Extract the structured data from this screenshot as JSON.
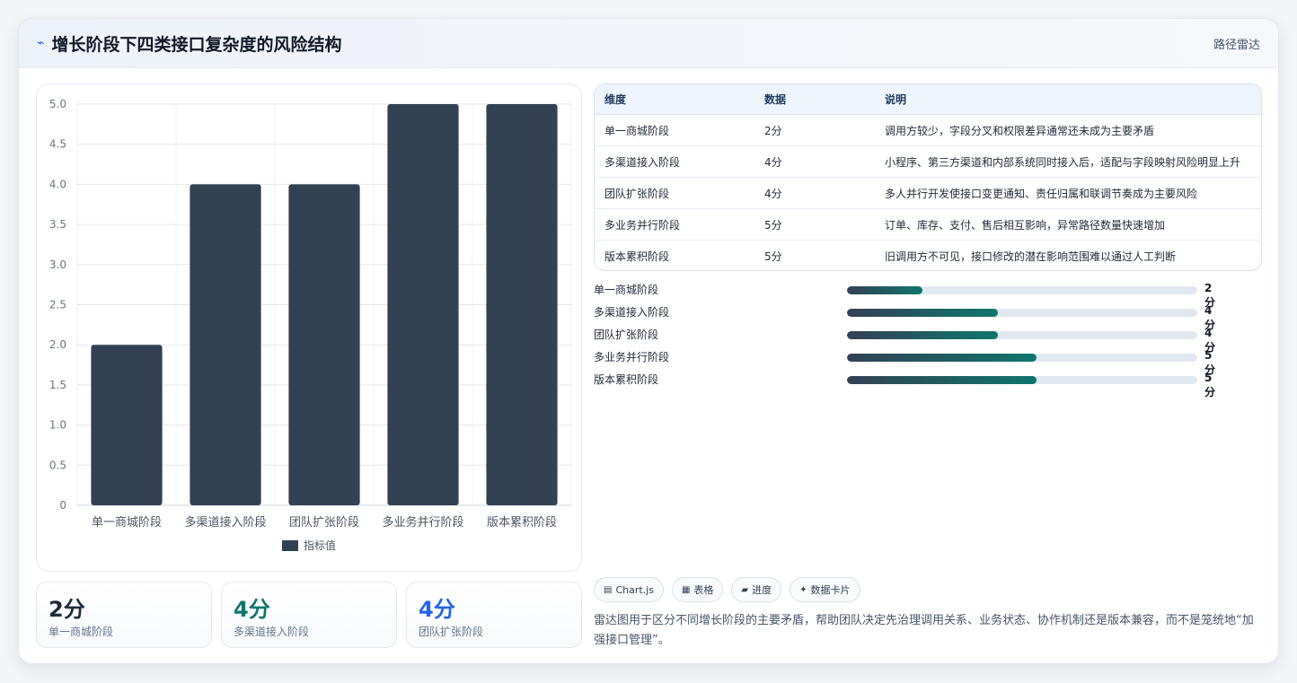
{
  "header": {
    "title": "增长阶段下四类接口复杂度的风险结构",
    "tag": "路径雷达",
    "icon": "pulse-icon"
  },
  "chart_data": {
    "type": "bar",
    "categories": [
      "单一商城阶段",
      "多渠道接入阶段",
      "团队扩张阶段",
      "多业务并行阶段",
      "版本累积阶段"
    ],
    "series": [
      {
        "name": "指标值",
        "values": [
          2,
          4,
          4,
          5,
          5
        ],
        "color": "#334155"
      }
    ],
    "ylim": [
      0,
      5
    ],
    "yticks": [
      "0",
      "0.5",
      "1.0",
      "1.5",
      "2.0",
      "2.5",
      "3.0",
      "3.5",
      "4.0",
      "4.5",
      "5.0"
    ],
    "grid": true,
    "legend": "bottom"
  },
  "stats": [
    {
      "value": "2分",
      "label": "单一商城阶段",
      "color": "#1f2937"
    },
    {
      "value": "4分",
      "label": "多渠道接入阶段",
      "color": "#0f766e"
    },
    {
      "value": "4分",
      "label": "团队扩张阶段",
      "color": "#2563eb"
    }
  ],
  "table": {
    "headers": [
      "维度",
      "数据",
      "说明"
    ],
    "rows": [
      [
        "单一商城阶段",
        "2分",
        "调用方较少，字段分叉和权限差异通常还未成为主要矛盾"
      ],
      [
        "多渠道接入阶段",
        "4分",
        "小程序、第三方渠道和内部系统同时接入后，适配与字段映射风险明显上升"
      ],
      [
        "团队扩张阶段",
        "4分",
        "多人并行开发使接口变更通知、责任归属和联调节奏成为主要风险"
      ],
      [
        "多业务并行阶段",
        "5分",
        "订单、库存、支付、售后相互影响，异常路径数量快速增加"
      ],
      [
        "版本累积阶段",
        "5分",
        "旧调用方不可见，接口修改的潜在影响范围难以通过人工判断"
      ]
    ]
  },
  "progress": [
    {
      "label": "单一商城阶段",
      "value": "2分",
      "fraction": 0.216
    },
    {
      "label": "多渠道接入阶段",
      "value": "4分",
      "fraction": 0.432
    },
    {
      "label": "团队扩张阶段",
      "value": "4分",
      "fraction": 0.432
    },
    {
      "label": "多业务并行阶段",
      "value": "5分",
      "fraction": 0.54
    },
    {
      "label": "版本累积阶段",
      "value": "5分",
      "fraction": 0.54
    }
  ],
  "chips": [
    {
      "icon": "chart-icon",
      "glyph": "▤",
      "label": "Chart.js"
    },
    {
      "icon": "table-icon",
      "glyph": "▦",
      "label": "表格"
    },
    {
      "icon": "progress-icon",
      "glyph": "▰",
      "label": "进度"
    },
    {
      "icon": "sparkle-icon",
      "glyph": "✦",
      "label": "数据卡片"
    }
  ],
  "note": "雷达图用于区分不同增长阶段的主要矛盾，帮助团队决定先治理调用关系、业务状态、协作机制还是版本兼容，而不是笼统地“加强接口管理”。"
}
